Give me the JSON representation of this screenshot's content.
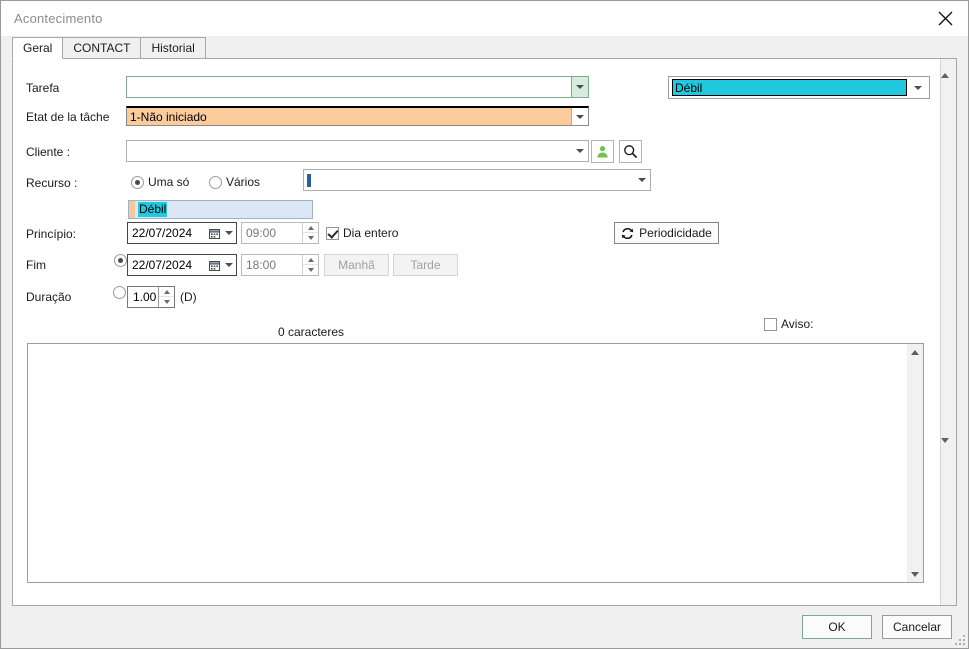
{
  "window": {
    "title": "Acontecimento",
    "close_icon": "close-icon"
  },
  "tabs": [
    {
      "label": "Geral",
      "active": true
    },
    {
      "label": "CONTACT",
      "active": false
    },
    {
      "label": "Historial",
      "active": false
    }
  ],
  "form": {
    "tarefa": {
      "label": "Tarefa",
      "value": ""
    },
    "estado": {
      "label": "Etat de la tâche",
      "value": "1-Não iniciado"
    },
    "cliente": {
      "label": "Cliente :",
      "value": ""
    },
    "prioridade": {
      "value": "Débil"
    },
    "recurso": {
      "label": "Recurso :",
      "radio_one": "Uma só",
      "radio_many": "Vários",
      "input_value": "",
      "suggestion": "Débil"
    },
    "principio": {
      "label": "Princípio:",
      "date": "22/07/2024",
      "time": "09:00",
      "dia_entero_label": "Dia entero"
    },
    "fim": {
      "label": "Fim",
      "date": "22/07/2024",
      "time": "18:00",
      "manha_label": "Manhã",
      "tarde_label": "Tarde"
    },
    "duracao": {
      "label": "Duração",
      "value": "1.00",
      "unit": "(D)"
    },
    "periodicidade_label": "Periodicidade",
    "aviso_label": "Aviso:",
    "char_count": "0 caracteres",
    "notes_value": ""
  },
  "footer": {
    "ok_label": "OK",
    "cancel_label": "Cancelar"
  },
  "colors": {
    "highlight_cyan": "#22c8e0",
    "status_orange": "#fbcb9c",
    "accent_green": "#7fa98c",
    "suggest_blue": "#dce7f5"
  }
}
